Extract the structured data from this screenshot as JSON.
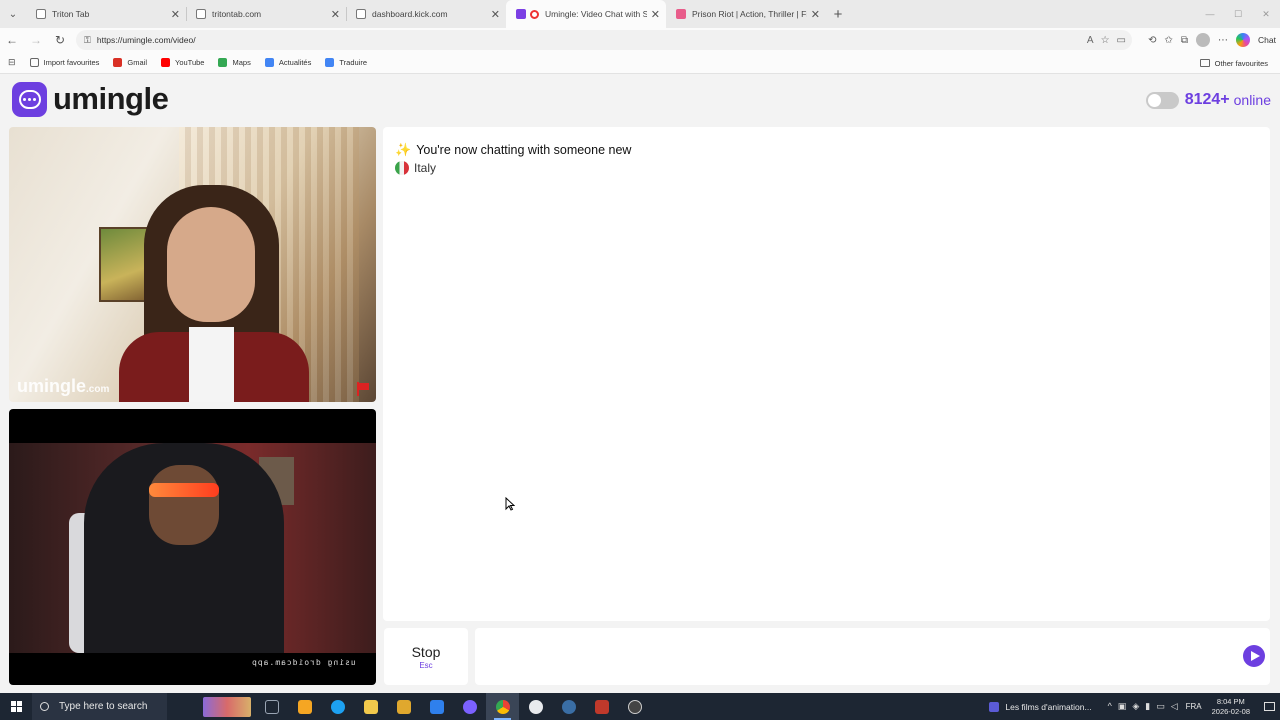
{
  "browser": {
    "tabs": [
      {
        "title": "Triton Tab",
        "favicon": "doc-icon",
        "active": false
      },
      {
        "title": "tritontab.com",
        "favicon": "doc-icon",
        "active": false
      },
      {
        "title": "dashboard.kick.com",
        "favicon": "doc-icon",
        "active": false
      },
      {
        "title": "Umingle: Video Chat with Str...",
        "favicon": "umingle-icon",
        "active": true
      },
      {
        "title": "Prison Riot | Action, Thriller | Film...",
        "favicon": "video-icon",
        "active": false
      }
    ],
    "url": "https://umingle.com/video/",
    "chat_button": "Chat",
    "bookmarks": [
      {
        "label": "Import favourites",
        "color": "#666666"
      },
      {
        "label": "Gmail",
        "color": "#d93025"
      },
      {
        "label": "YouTube",
        "color": "#ff0000"
      },
      {
        "label": "Maps",
        "color": "#34a853"
      },
      {
        "label": "Actualités",
        "color": "#4285f4"
      },
      {
        "label": "Traduire",
        "color": "#4285f4"
      }
    ],
    "other_favourites": "Other favourites"
  },
  "site": {
    "logo_text": "umingle",
    "brand_color": "#6d3fe0",
    "online_count": "8124+",
    "online_label": "online"
  },
  "video": {
    "watermark_main": "umingle",
    "watermark_suffix": ".com",
    "local_overlay": "using droidcam.app"
  },
  "chat": {
    "status_message": "You're now chatting with someone new",
    "country": "Italy"
  },
  "controls": {
    "stop_label": "Stop",
    "stop_shortcut": "Esc",
    "message_placeholder": ""
  },
  "taskbar": {
    "search_placeholder": "Type here to search",
    "app_colors": [
      "#9aa5b4",
      "#f5a623",
      "#1da1f2",
      "#f2c94c",
      "#e0a82e",
      "#2f80ed",
      "#7b61ff",
      "#34a853",
      "#e8eaed",
      "#1b2838",
      "#c0392b",
      "#444444"
    ],
    "notification_text": "Les films d'animation...",
    "language": "FRA",
    "time": "8:04 PM",
    "date": "2026-02-08"
  }
}
